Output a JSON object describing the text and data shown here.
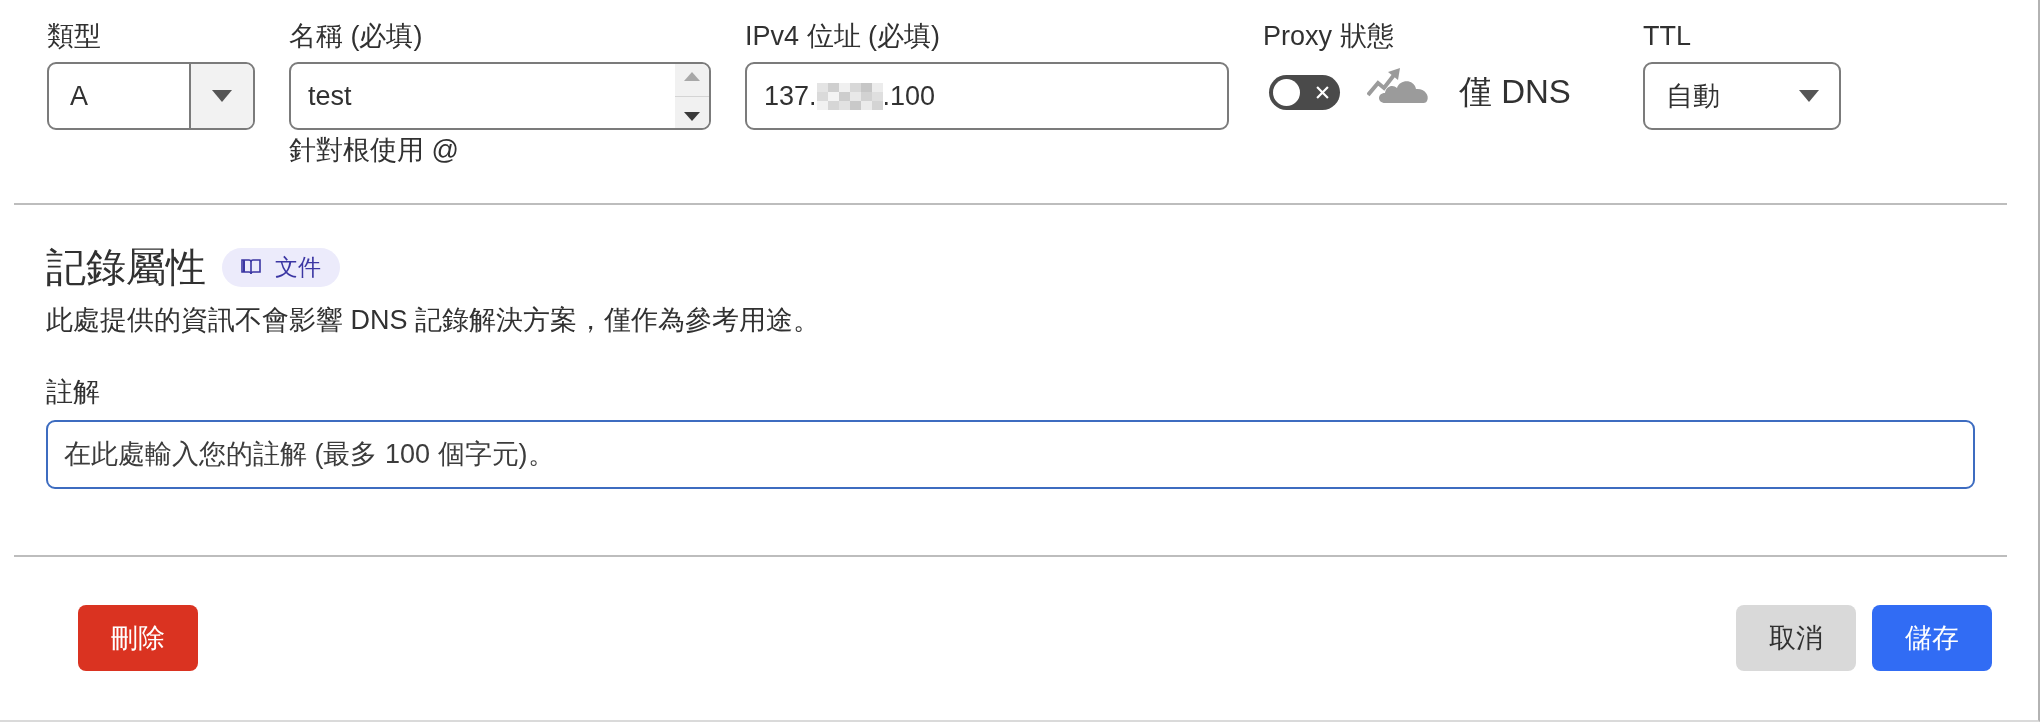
{
  "fields": [
    {
      "kind": "dropdown",
      "label": "類型",
      "value": "A"
    },
    {
      "kind": "number",
      "label": "名稱 (必填)",
      "value": "test",
      "hint": "針對根使用 @"
    },
    {
      "kind": "text",
      "label": "IPv4 位址 (必填)",
      "value_start": "137.",
      "value_end": ".100",
      "redacted": true
    },
    {
      "kind": "toggle",
      "label": "Proxy 狀態",
      "on": false,
      "status": "僅 DNS"
    },
    {
      "kind": "select",
      "label": "TTL",
      "value": "自動"
    }
  ],
  "record_attributes": {
    "title": "記錄屬性",
    "docs_link": "文件",
    "description": "此處提供的資訊不會影響 DNS 記錄解決方案，僅作為參考用途。"
  },
  "comment": {
    "label": "註解",
    "placeholder": "在此處輸入您的註解 (最多 100 個字元)。",
    "focused": true
  },
  "buttons": [
    {
      "kind": "danger",
      "label": "刪除"
    },
    {
      "kind": "secondary",
      "label": "取消"
    },
    {
      "kind": "primary",
      "label": "儲存"
    }
  ]
}
